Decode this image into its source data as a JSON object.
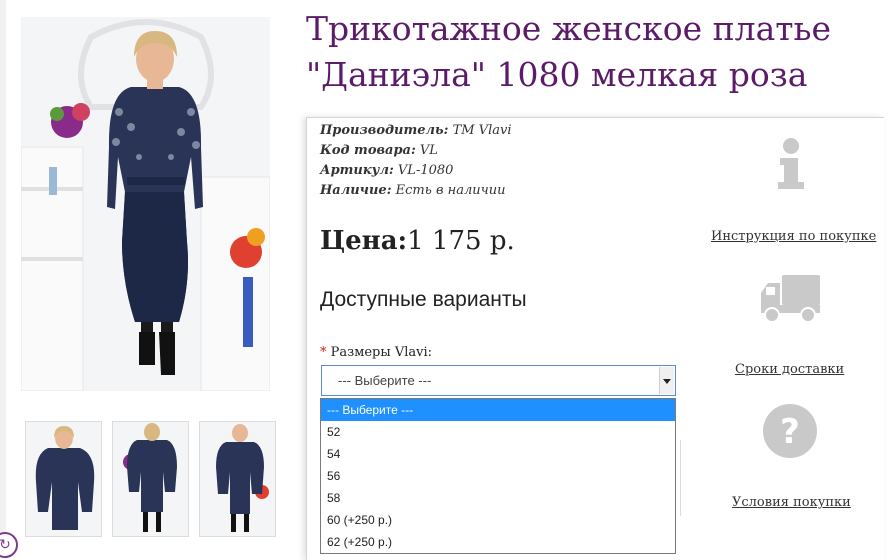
{
  "product": {
    "title_line1": "Трикотажное женское платье",
    "title_line2": "\"Даниэла\" 1080 мелкая роза",
    "manufacturer_label": "Производитель:",
    "manufacturer_value": "ТМ Vlavi",
    "code_label": "Код товара:",
    "code_value": "VL",
    "article_label": "Артикул:",
    "article_value": "VL-1080",
    "availability_label": "Наличие:",
    "availability_value": "Есть в наличии",
    "price_label": "Цена:",
    "price_value": "1 175 р."
  },
  "options": {
    "heading": "Доступные варианты",
    "required_mark": "*",
    "size_label": "Размеры Vlavi:",
    "selected": "--- Выберите ---",
    "items": [
      "--- Выберите ---",
      "52",
      "54",
      "56",
      "58",
      "60 (+250 р.)",
      "62 (+250 р.)"
    ]
  },
  "links": {
    "instructions": "Инструкция по покупке",
    "delivery": "Сроки доставки",
    "conditions": "Условия покупки"
  },
  "icons": {
    "info": "info-icon",
    "truck": "truck-icon",
    "question": "question-icon",
    "corner": "refresh-icon"
  },
  "colors": {
    "title": "#5b1b68",
    "dropdown_highlight": "#1e90ff",
    "select_border": "#5a8ccc",
    "icon_gray": "#c9c9c9",
    "dress_navy": "#1c2846"
  }
}
